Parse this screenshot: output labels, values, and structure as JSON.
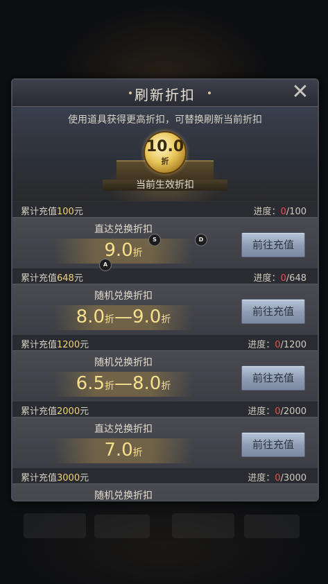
{
  "dialog": {
    "title": "刷新折扣",
    "close_glyph": "✕",
    "subtitle": "使用道具获得更高折扣，可替换刷新当前折扣",
    "current": {
      "value": "10.0",
      "unit": "折",
      "label": "当前生效折扣"
    }
  },
  "tiers": [
    {
      "cum_prefix": "累计充值",
      "amount": "100",
      "cum_suffix": "元",
      "progress_label": "进度：",
      "progress_current": "0",
      "progress_sep": "/",
      "progress_total": "100",
      "type": "直达兑换折扣",
      "rate_from": "9.0",
      "rate_to": "",
      "unit": "折",
      "dash": "",
      "button": "前往充值"
    },
    {
      "cum_prefix": "累计充值",
      "amount": "648",
      "cum_suffix": "元",
      "progress_label": "进度：",
      "progress_current": "0",
      "progress_sep": "/",
      "progress_total": "648",
      "type": "随机兑换折扣",
      "rate_from": "8.0",
      "rate_to": "9.0",
      "unit": "折",
      "dash": "—",
      "button": "前往充值"
    },
    {
      "cum_prefix": "累计充值",
      "amount": "1200",
      "cum_suffix": "元",
      "progress_label": "进度：",
      "progress_current": "0",
      "progress_sep": "/",
      "progress_total": "1200",
      "type": "随机兑换折扣",
      "rate_from": "6.5",
      "rate_to": "8.0",
      "unit": "折",
      "dash": "—",
      "button": "前往充值"
    },
    {
      "cum_prefix": "累计充值",
      "amount": "2000",
      "cum_suffix": "元",
      "progress_label": "进度：",
      "progress_current": "0",
      "progress_sep": "/",
      "progress_total": "2000",
      "type": "直达兑换折扣",
      "rate_from": "7.0",
      "rate_to": "",
      "unit": "折",
      "dash": "",
      "button": "前往充值"
    },
    {
      "cum_prefix": "累计充值",
      "amount": "3000",
      "cum_suffix": "元",
      "progress_label": "进度：",
      "progress_current": "0",
      "progress_sep": "/",
      "progress_total": "3000",
      "type": "随机兑换折扣",
      "rate_from": "",
      "rate_to": "",
      "unit": "",
      "dash": "",
      "button": ""
    }
  ],
  "overlay_markers": [
    "S",
    "D",
    "A"
  ],
  "colors": {
    "amount": "#f0d37a",
    "progress_current": "#e2534a",
    "button": "#8e9bb2"
  }
}
